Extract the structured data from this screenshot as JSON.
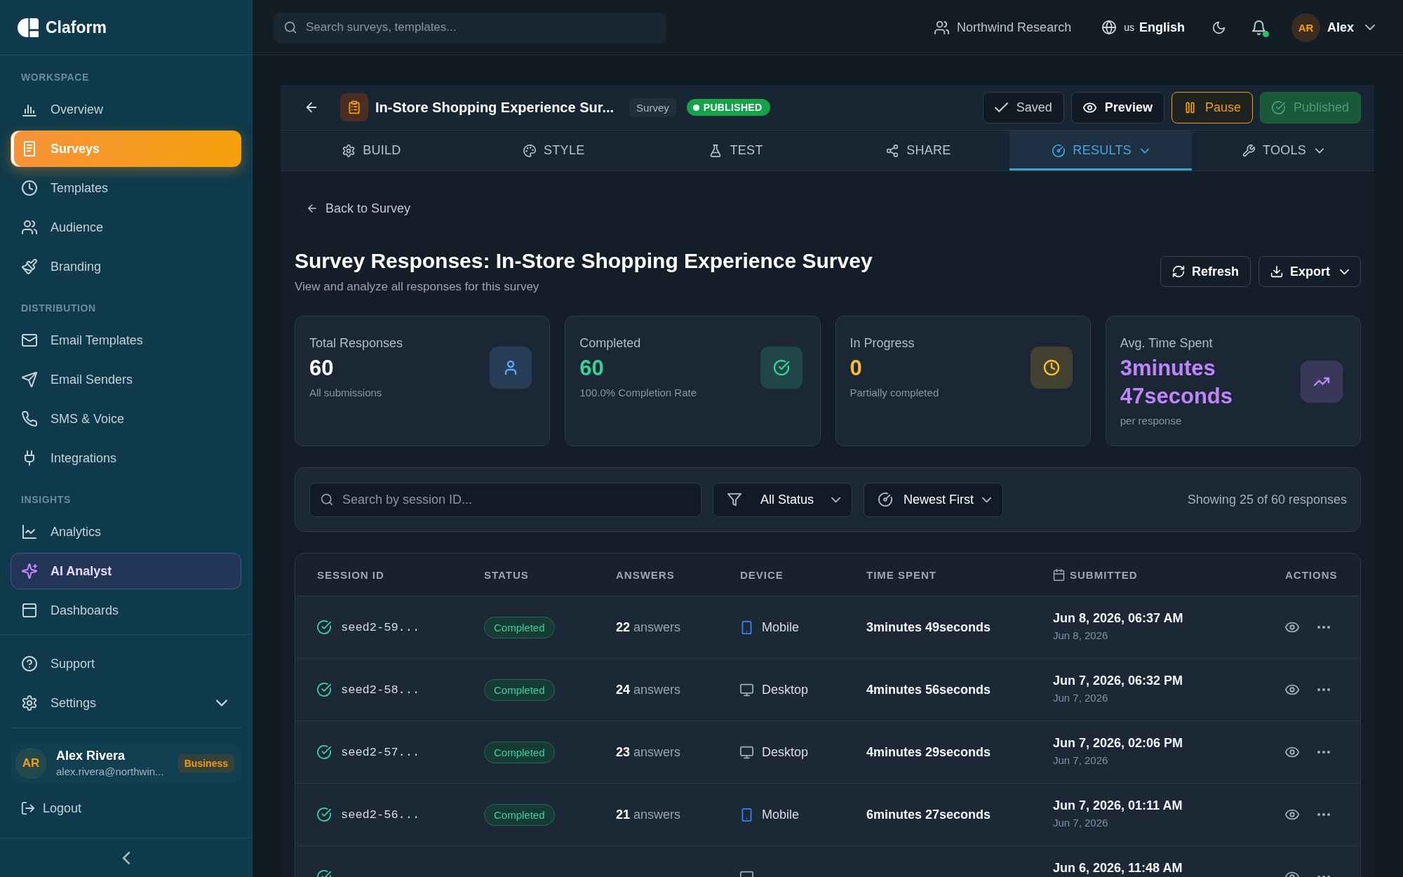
{
  "sidebar": {
    "logo": "Claform",
    "sections": [
      {
        "title": "WORKSPACE",
        "items": [
          {
            "label": "Overview",
            "kind": "link",
            "selected": false
          },
          {
            "label": "Surveys",
            "kind": "link",
            "selected": true
          },
          {
            "label": "Templates",
            "kind": "link",
            "selected": false
          },
          {
            "label": "Audience",
            "kind": "link",
            "selected": false
          },
          {
            "label": "Branding",
            "kind": "link",
            "selected": false
          }
        ]
      },
      {
        "title": "DISTRIBUTION",
        "items": [
          {
            "label": "Email Templates",
            "kind": "link",
            "selected": false
          },
          {
            "label": "Email Senders",
            "kind": "link",
            "selected": false
          },
          {
            "label": "SMS & Voice",
            "kind": "link",
            "selected": false
          },
          {
            "label": "Integrations",
            "kind": "link",
            "selected": false
          }
        ]
      },
      {
        "title": "INSIGHTS",
        "items": [
          {
            "label": "Analytics",
            "kind": "link",
            "selected": false
          },
          {
            "label": "AI Analyst",
            "kind": "featured",
            "selected": false
          },
          {
            "label": "Dashboards",
            "kind": "link",
            "selected": false
          }
        ]
      }
    ],
    "footer_items": [
      {
        "label": "Support",
        "kind": "link",
        "selected": false
      },
      {
        "label": "Settings",
        "kind": "group",
        "selected": false
      }
    ],
    "user": {
      "initials": "AR",
      "name": "Alex Rivera",
      "email": "alex.rivera@northwin...",
      "plan": "Business"
    },
    "logout": "Logout"
  },
  "top_bar": {
    "search": {
      "placeholder": "Search surveys, templates..."
    },
    "workspace": "Northwind Research",
    "language": {
      "code": "us",
      "label": "English"
    },
    "notifications": {
      "unread": true
    },
    "user": {
      "initials": "AR",
      "name": "Alex"
    }
  },
  "survey": {
    "title": "In-Store Shopping Experience Sur...",
    "type": "Survey",
    "status": "PUBLISHED",
    "actions": [
      {
        "label": "Saved",
        "kind": "status",
        "disabled": false
      },
      {
        "label": "Preview",
        "kind": "secondary",
        "disabled": false
      },
      {
        "label": "Pause",
        "kind": "warning",
        "disabled": false
      },
      {
        "label": "Published",
        "kind": "success",
        "disabled": true
      }
    ]
  },
  "tabs": [
    {
      "label": "BUILD",
      "selected": false,
      "dropdown": false
    },
    {
      "label": "STYLE",
      "selected": false,
      "dropdown": false
    },
    {
      "label": "TEST",
      "selected": false,
      "dropdown": false
    },
    {
      "label": "SHARE",
      "selected": false,
      "dropdown": false
    },
    {
      "label": "RESULTS",
      "selected": true,
      "dropdown": true
    },
    {
      "label": "TOOLS",
      "selected": false,
      "dropdown": true
    }
  ],
  "page": {
    "back_link": "Back to Survey",
    "title": "Survey Responses: In-Store Shopping Experience Survey",
    "subtitle": "View and analyze all responses for this survey",
    "actions": [
      {
        "label": "Refresh",
        "dropdown": false
      },
      {
        "label": "Export",
        "dropdown": true
      }
    ]
  },
  "stats": [
    {
      "label": "Total Responses",
      "value": "60",
      "note": "All submissions",
      "color": "#60a5fa",
      "tinted_value": false
    },
    {
      "label": "Completed",
      "value": "60",
      "note": "100.0% Completion Rate",
      "color": "#34d399",
      "tinted_value": true
    },
    {
      "label": "In Progress",
      "value": "0",
      "note": "Partially completed",
      "color": "#fbbf24",
      "tinted_value": true
    },
    {
      "label": "Avg. Time Spent",
      "value": "3minutes 47seconds",
      "note": "per response",
      "color": "#c084fc",
      "tinted_value": true
    }
  ],
  "filters": {
    "search": {
      "placeholder": "Search by session ID..."
    },
    "status_filter": "All Status",
    "sort": "Newest First",
    "summary": "Showing 25 of 60 responses"
  },
  "table": {
    "columns": [
      {
        "label": "SESSION ID",
        "kind": "text"
      },
      {
        "label": "STATUS",
        "kind": "text"
      },
      {
        "label": "ANSWERS",
        "kind": "text"
      },
      {
        "label": "DEVICE",
        "kind": "text"
      },
      {
        "label": "TIME SPENT",
        "kind": "text"
      },
      {
        "label": "SUBMITTED",
        "kind": "date"
      },
      {
        "label": "ACTIONS",
        "kind": "text"
      }
    ],
    "rows": [
      {
        "session_id": "seed2-59...",
        "status": {
          "label": "Completed",
          "kind": "completed"
        },
        "answers": "**22** answers",
        "device": {
          "kind": "mobile",
          "label": "Mobile"
        },
        "time_spent": "3minutes 49seconds",
        "submitted": "Jun 8, 2026, 06:37 AM",
        "submitted_date": "Jun 8, 2026"
      },
      {
        "session_id": "seed2-58...",
        "status": {
          "label": "Completed",
          "kind": "completed"
        },
        "answers": "**24** answers",
        "device": {
          "kind": "desktop",
          "label": "Desktop"
        },
        "time_spent": "4minutes 56seconds",
        "submitted": "Jun 7, 2026, 06:32 PM",
        "submitted_date": "Jun 7, 2026"
      },
      {
        "session_id": "seed2-57...",
        "status": {
          "label": "Completed",
          "kind": "completed"
        },
        "answers": "**23** answers",
        "device": {
          "kind": "desktop",
          "label": "Desktop"
        },
        "time_spent": "4minutes 29seconds",
        "submitted": "Jun 7, 2026, 02:06 PM",
        "submitted_date": "Jun 7, 2026"
      },
      {
        "session_id": "seed2-56...",
        "status": {
          "label": "Completed",
          "kind": "completed"
        },
        "answers": "**21** answers",
        "device": {
          "kind": "mobile",
          "label": "Mobile"
        },
        "time_spent": "6minutes 27seconds",
        "submitted": "Jun 7, 2026, 01:11 AM",
        "submitted_date": "Jun 7, 2026"
      },
      {
        "status": {
          "kind": "completed"
        },
        "device": {
          "kind": "desktop"
        },
        "submitted": "Jun 6, 2026, 11:48 AM"
      }
    ]
  }
}
